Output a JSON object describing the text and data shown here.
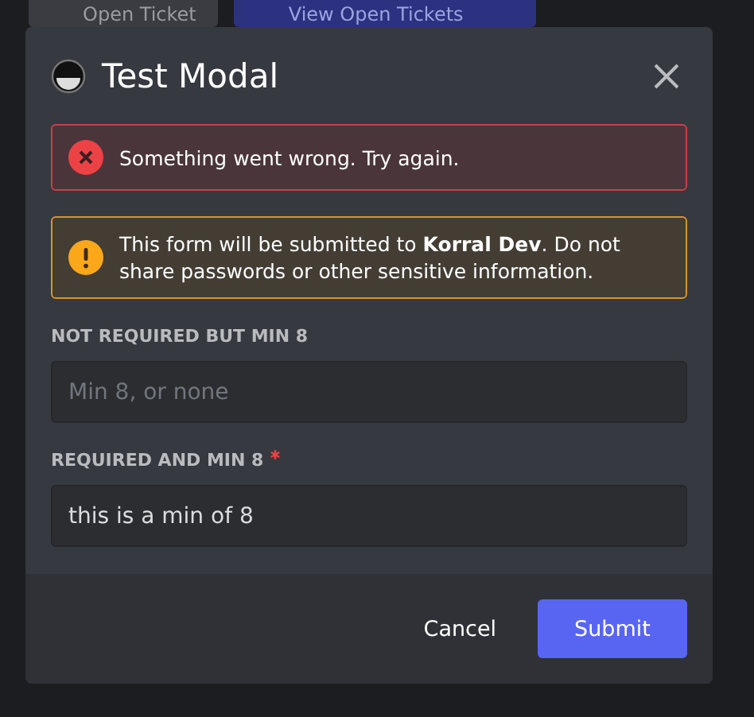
{
  "background_buttons": [
    {
      "label": "Open Ticket"
    },
    {
      "label": "View Open Tickets"
    }
  ],
  "modal": {
    "title": "Test Modal",
    "alerts": [
      {
        "kind": "error",
        "text": "Something went wrong. Try again."
      },
      {
        "kind": "warning",
        "text": "This form will be submitted to **Korral Dev**. Do not share passwords or other sensitive information."
      }
    ],
    "fields": [
      {
        "label": "NOT REQUIRED BUT MIN 8",
        "required": false,
        "placeholder": "Min 8, or none"
      },
      {
        "label": "REQUIRED AND MIN 8",
        "required": true,
        "value": "this is a min of 8"
      }
    ],
    "buttons": [
      {
        "label": "Cancel",
        "kind": "link"
      },
      {
        "label": "Submit",
        "kind": "primary"
      }
    ]
  }
}
